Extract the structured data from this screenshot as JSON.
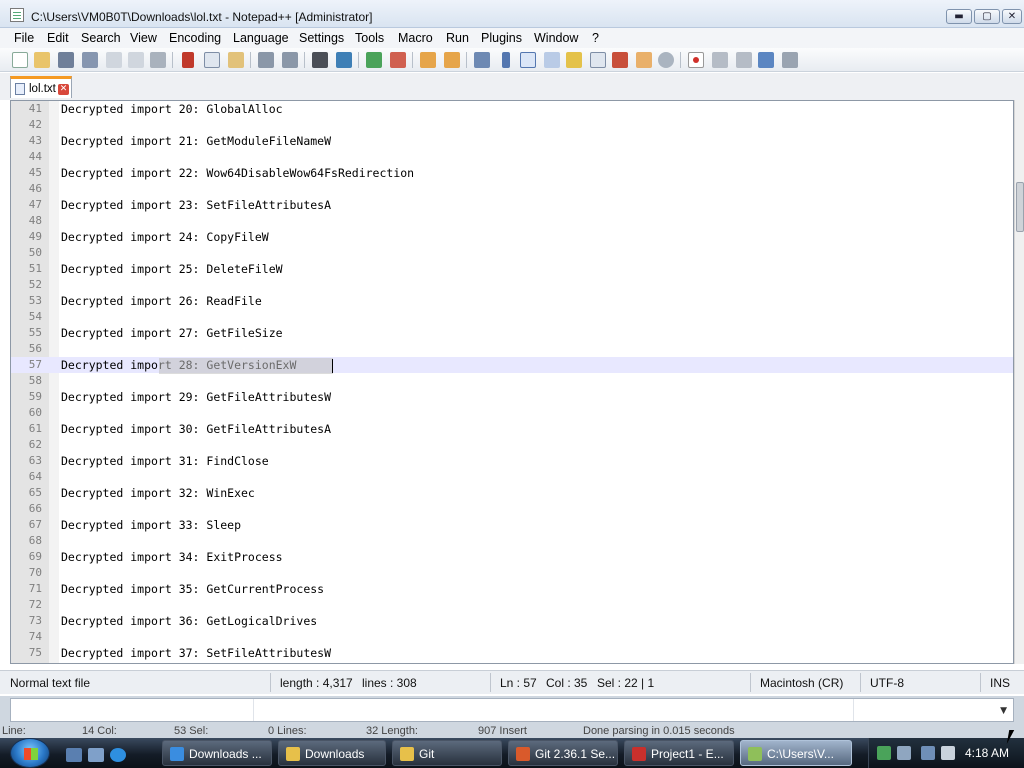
{
  "window": {
    "title": "C:\\Users\\VM0B0T\\Downloads\\lol.txt - Notepad++ [Administrator]",
    "min_glyph": "▬",
    "max_glyph": "▢",
    "close_glyph": "✕"
  },
  "menu": [
    "File",
    "Edit",
    "Search",
    "View",
    "Encoding",
    "Language",
    "Settings",
    "Tools",
    "Macro",
    "Run",
    "Plugins",
    "Window",
    "?"
  ],
  "toolbar_icons": [
    "new-icon",
    "open-icon",
    "save-icon",
    "save-all-icon",
    "close-icon",
    "close-all-icon",
    "print-icon",
    "cut-icon",
    "copy-icon",
    "paste-icon",
    "undo-icon",
    "redo-icon",
    "find-icon",
    "replace-icon",
    "zoom-in-icon",
    "zoom-out-icon",
    "sync-v-icon",
    "sync-h-icon",
    "word-wrap-icon",
    "show-all-chars-icon",
    "indent-guide-icon",
    "udl-icon",
    "doc-map-icon",
    "function-list-icon",
    "folder-workspace-icon",
    "monitor-icon",
    "record-macro-icon",
    "stop-macro-icon",
    "play-macro-icon",
    "run-macro-multiple-icon",
    "save-macro-icon"
  ],
  "tab": {
    "label": "lol.txt",
    "close_glyph": "✕"
  },
  "editor": {
    "lines": [
      {
        "n": "41",
        "text": "Decrypted import 20: GlobalAlloc"
      },
      {
        "n": "42",
        "text": ""
      },
      {
        "n": "43",
        "text": "Decrypted import 21: GetModuleFileNameW"
      },
      {
        "n": "44",
        "text": ""
      },
      {
        "n": "45",
        "text": "Decrypted import 22: Wow64DisableWow64FsRedirection"
      },
      {
        "n": "46",
        "text": ""
      },
      {
        "n": "47",
        "text": "Decrypted import 23: SetFileAttributesA"
      },
      {
        "n": "48",
        "text": ""
      },
      {
        "n": "49",
        "text": "Decrypted import 24: CopyFileW"
      },
      {
        "n": "50",
        "text": ""
      },
      {
        "n": "51",
        "text": "Decrypted import 25: DeleteFileW"
      },
      {
        "n": "52",
        "text": ""
      },
      {
        "n": "53",
        "text": "Decrypted import 26: ReadFile"
      },
      {
        "n": "54",
        "text": ""
      },
      {
        "n": "55",
        "text": "Decrypted import 27: GetFileSize"
      },
      {
        "n": "56",
        "text": ""
      },
      {
        "n": "57",
        "text": "Decrypted import 28: GetVersionExW"
      },
      {
        "n": "58",
        "text": ""
      },
      {
        "n": "59",
        "text": "Decrypted import 29: GetFileAttributesW"
      },
      {
        "n": "60",
        "text": ""
      },
      {
        "n": "61",
        "text": "Decrypted import 30: GetFileAttributesA"
      },
      {
        "n": "62",
        "text": ""
      },
      {
        "n": "63",
        "text": "Decrypted import 31: FindClose"
      },
      {
        "n": "64",
        "text": ""
      },
      {
        "n": "65",
        "text": "Decrypted import 32: WinExec"
      },
      {
        "n": "66",
        "text": ""
      },
      {
        "n": "67",
        "text": "Decrypted import 33: Sleep"
      },
      {
        "n": "68",
        "text": ""
      },
      {
        "n": "69",
        "text": "Decrypted import 34: ExitProcess"
      },
      {
        "n": "70",
        "text": ""
      },
      {
        "n": "71",
        "text": "Decrypted import 35: GetCurrentProcess"
      },
      {
        "n": "72",
        "text": ""
      },
      {
        "n": "73",
        "text": "Decrypted import 36: GetLogicalDrives"
      },
      {
        "n": "74",
        "text": ""
      },
      {
        "n": "75",
        "text": "Decrypted import 37: SetFileAttributesW"
      }
    ]
  },
  "status": {
    "file_type": "Normal text file",
    "length": "length : 4,317",
    "lines": "lines : 308",
    "ln": "Ln : 57",
    "col": "Col : 35",
    "sel": "Sel : 22 | 1",
    "eol": "Macintosh (CR)",
    "encoding": "UTF-8",
    "mode": "INS"
  },
  "bottom_pane": {
    "labels": [
      "Line:",
      "14 Col:",
      "53 Sel:",
      "0 Lines:",
      "32 Length:",
      "907 Insert",
      "Done parsing in 0.015 seconds"
    ],
    "dropdown_glyph": "▼"
  },
  "taskbar": {
    "quick_launch": [
      "show-desktop-icon",
      "switch-windows-icon",
      "internet-explorer-icon"
    ],
    "tasks": [
      {
        "label": "Downloads ...",
        "icon": "chrome-icon",
        "color": "#3a8de0"
      },
      {
        "label": "Downloads",
        "icon": "folder-icon",
        "color": "#e7c04a"
      },
      {
        "label": "Git",
        "icon": "folder-icon",
        "color": "#e7c04a"
      },
      {
        "label": "Git 2.36.1 Se...",
        "icon": "git-setup-icon",
        "color": "#d95a2b"
      },
      {
        "label": "Project1 - E...",
        "icon": "dev-cpp-icon",
        "color": "#c9302c"
      },
      {
        "label": "C:\\Users\\V...",
        "icon": "notepad-plus-plus-icon",
        "color": "#8fbf5a"
      }
    ],
    "clock": "4:18 AM"
  },
  "colors": {
    "current_line": "#e8e8ff",
    "selection": "#c0c0c0",
    "tab_accent": "#f59a23"
  }
}
